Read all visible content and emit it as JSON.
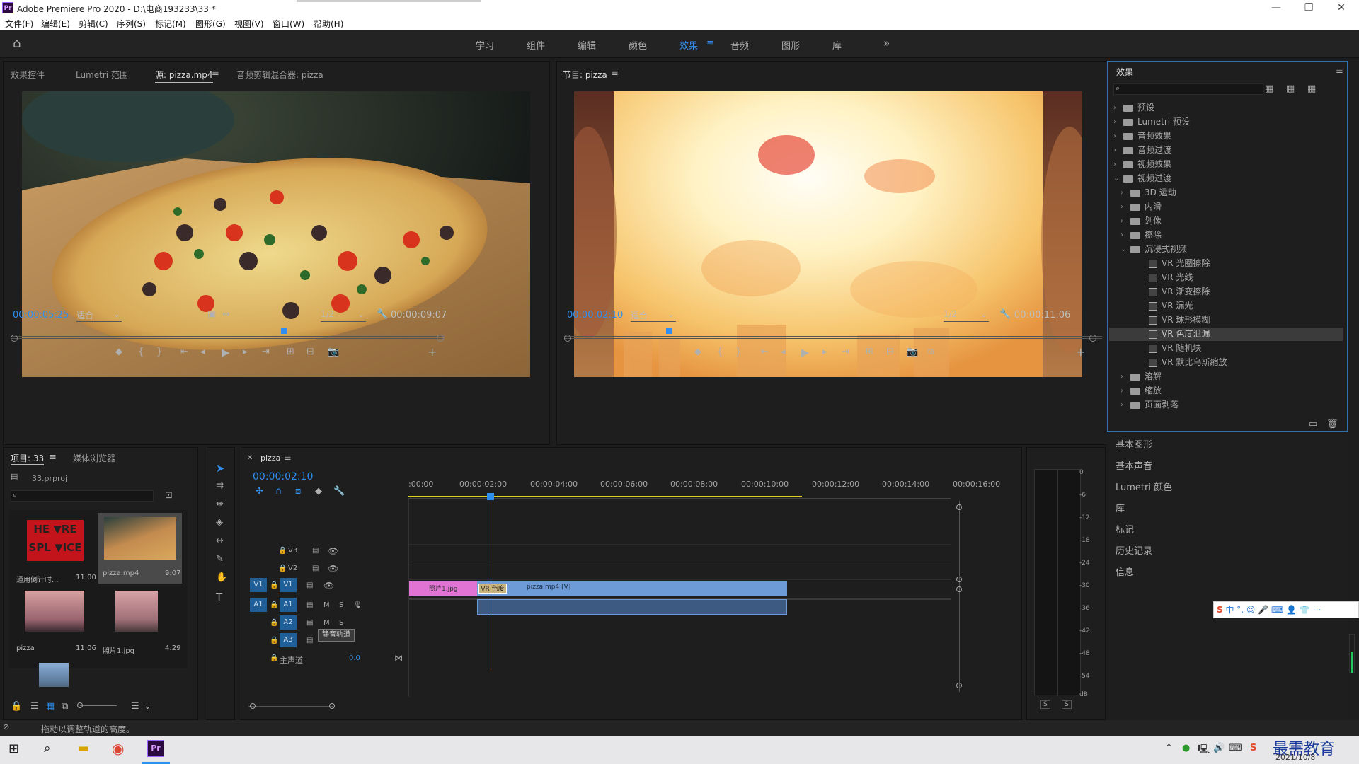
{
  "window": {
    "title": "Adobe Premiere Pro 2020 - D:\\电商193233\\33 *",
    "logo": "Pr"
  },
  "menu": [
    "文件(F)",
    "编辑(E)",
    "剪辑(C)",
    "序列(S)",
    "标记(M)",
    "图形(G)",
    "视图(V)",
    "窗口(W)",
    "帮助(H)"
  ],
  "workspaces": [
    "学习",
    "组件",
    "编辑",
    "颜色",
    "效果",
    "音频",
    "图形",
    "库"
  ],
  "active_workspace": "效果",
  "source_panel": {
    "tabs": [
      "效果控件",
      "Lumetri 范围",
      "源: pizza.mp4",
      "音频剪辑混合器: pizza"
    ],
    "timecode": "00:00:05:25",
    "fit": "适合",
    "resolution": "1/2",
    "duration": "00:00:09:07"
  },
  "program_panel": {
    "tab": "节目: pizza",
    "timecode": "00:00:02:10",
    "fit": "适合",
    "resolution": "1/2",
    "duration": "00:00:11:06"
  },
  "effects_panel": {
    "title": "效果",
    "tree": [
      {
        "label": "预设",
        "depth": 0,
        "type": "folder",
        "open": false
      },
      {
        "label": "Lumetri 预设",
        "depth": 0,
        "type": "folder",
        "open": false
      },
      {
        "label": "音频效果",
        "depth": 0,
        "type": "folder",
        "open": false
      },
      {
        "label": "音频过渡",
        "depth": 0,
        "type": "folder",
        "open": false
      },
      {
        "label": "视频效果",
        "depth": 0,
        "type": "folder",
        "open": false
      },
      {
        "label": "视频过渡",
        "depth": 0,
        "type": "folder",
        "open": true
      },
      {
        "label": "3D 运动",
        "depth": 1,
        "type": "folder",
        "open": false
      },
      {
        "label": "内滑",
        "depth": 1,
        "type": "folder",
        "open": false
      },
      {
        "label": "划像",
        "depth": 1,
        "type": "folder",
        "open": false
      },
      {
        "label": "擦除",
        "depth": 1,
        "type": "folder",
        "open": false
      },
      {
        "label": "沉浸式视频",
        "depth": 1,
        "type": "folder",
        "open": true
      },
      {
        "label": "VR 光圈擦除",
        "depth": 2,
        "type": "effect"
      },
      {
        "label": "VR 光线",
        "depth": 2,
        "type": "effect"
      },
      {
        "label": "VR 渐变擦除",
        "depth": 2,
        "type": "effect"
      },
      {
        "label": "VR 漏光",
        "depth": 2,
        "type": "effect"
      },
      {
        "label": "VR 球形模糊",
        "depth": 2,
        "type": "effect"
      },
      {
        "label": "VR 色度泄漏",
        "depth": 2,
        "type": "effect",
        "selected": true
      },
      {
        "label": "VR 随机块",
        "depth": 2,
        "type": "effect"
      },
      {
        "label": "VR 默比乌斯缩放",
        "depth": 2,
        "type": "effect"
      },
      {
        "label": "溶解",
        "depth": 1,
        "type": "folder",
        "open": false
      },
      {
        "label": "缩放",
        "depth": 1,
        "type": "folder",
        "open": false
      },
      {
        "label": "页面剥落",
        "depth": 1,
        "type": "folder",
        "open": false
      }
    ]
  },
  "side_panels": [
    "基本图形",
    "基本声音",
    "Lumetri 颜色",
    "库",
    "标记",
    "历史记录",
    "信息"
  ],
  "project_panel": {
    "tabs": [
      "项目: 33",
      "媒体浏览器"
    ],
    "file": "33.prproj",
    "items": [
      {
        "name": "通用倒计时...",
        "dur": "11:00"
      },
      {
        "name": "pizza.mp4",
        "dur": "9:07"
      },
      {
        "name": "pizza",
        "dur": "11:06"
      },
      {
        "name": "照片1.jpg",
        "dur": "4:29"
      }
    ]
  },
  "timeline": {
    "tab": "pizza",
    "timecode": "00:00:02:10",
    "ruler": [
      ":00:00",
      "00:00:02:00",
      "00:00:04:00",
      "00:00:06:00",
      "00:00:08:00",
      "00:00:10:00",
      "00:00:12:00",
      "00:00:14:00",
      "00:00:16:00"
    ],
    "tracks": [
      "V3",
      "V2",
      "V1",
      "A1",
      "A2",
      "A3"
    ],
    "master": "主声道",
    "master_val": "0.0",
    "clips": {
      "photo": "照片1.jpg",
      "transition": "VR 色度",
      "video": "pizza.mp4 [V]"
    },
    "tooltip": "静音轨道",
    "mute": "M",
    "solo": "S"
  },
  "meter": {
    "labels": [
      "0",
      "-6",
      "-12",
      "-18",
      "-24",
      "-30",
      "-36",
      "-42",
      "-48",
      "-54",
      "dB"
    ],
    "solo": [
      "S",
      "S"
    ]
  },
  "status": "拖动以调整轨道的高度。",
  "taskbar": {
    "date": "2021/10/8",
    "watermark": "最需教育"
  }
}
